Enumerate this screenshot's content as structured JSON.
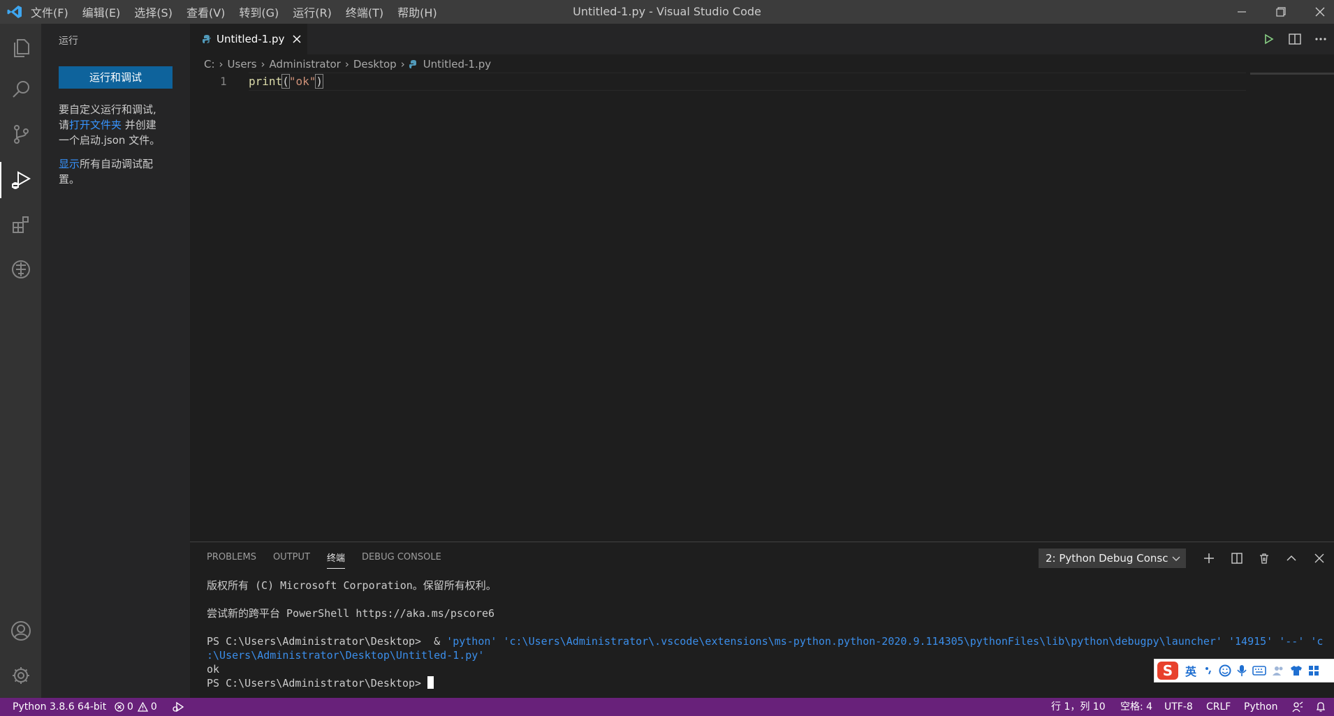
{
  "titlebar": {
    "menu": [
      "文件(F)",
      "编辑(E)",
      "选择(S)",
      "查看(V)",
      "转到(G)",
      "运行(R)",
      "终端(T)",
      "帮助(H)"
    ],
    "title": "Untitled-1.py - Visual Studio Code"
  },
  "activity_icons": [
    "files-icon",
    "search-icon",
    "source-control-icon",
    "run-debug-icon",
    "extensions-icon",
    "remote-explorer-icon",
    "accounts-icon",
    "settings-gear-icon"
  ],
  "sidebar": {
    "title": "运行",
    "run_button": "运行和调试",
    "text1_a": "要自定义运行和调试,",
    "text1_b": "请",
    "text1_link": "打开文件夹",
    "text1_c": " 并创建",
    "text1_d": "一个启动.json 文件。",
    "text2_link": "显示",
    "text2_a": "所有自动调试配",
    "text2_b": "置。"
  },
  "editor": {
    "tab_label": "Untitled-1.py",
    "breadcrumb": [
      "C:",
      "Users",
      "Administrator",
      "Desktop",
      "Untitled-1.py"
    ],
    "line_number": "1",
    "code_fn": "print",
    "code_open": "(",
    "code_str": "\"ok\"",
    "code_close": ")"
  },
  "panel": {
    "tabs": [
      "PROBLEMS",
      "OUTPUT",
      "终端",
      "DEBUG CONSOLE"
    ],
    "active_tab": "终端",
    "terminal_select": "2: Python Debug Consc",
    "terminal": {
      "line1": "版权所有 (C) Microsoft Corporation。保留所有权利。",
      "line2": "尝试新的跨平台 PowerShell https://aka.ms/pscore6",
      "prompt": "PS C:\\Users\\Administrator\\Desktop>",
      "cmd_amp": "  & ",
      "cmd_args": "'python' 'c:\\Users\\Administrator\\.vscode\\extensions\\ms-python.python-2020.9.114305\\pythonFiles\\lib\\python\\debugpy\\launcher' '14915' '--' 'c",
      "cmd_args2": ":\\Users\\Administrator\\Desktop\\Untitled-1.py'",
      "output": "ok",
      "prompt2": "PS C:\\Users\\Administrator\\Desktop> "
    }
  },
  "ime": {
    "logo": "S",
    "lang": "英"
  },
  "statusbar": {
    "interpreter": "Python 3.8.6 64-bit",
    "errors": "0",
    "warnings": "0",
    "position": "行 1，列 10",
    "spaces": "空格: 4",
    "encoding": "UTF-8",
    "eol": "CRLF",
    "language": "Python"
  },
  "colors": {
    "statusbar": "#68217a",
    "accent": "#0e639c",
    "link": "#3794ff"
  }
}
